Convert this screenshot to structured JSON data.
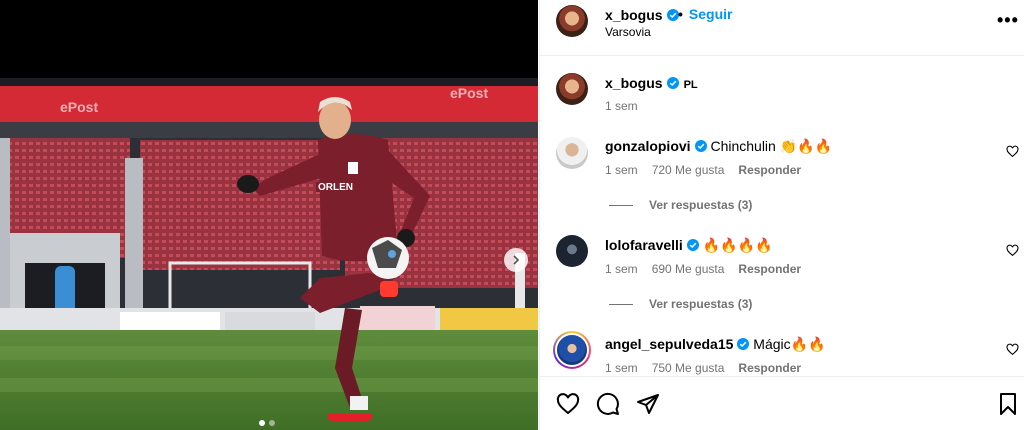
{
  "post": {
    "author": "x_bogus",
    "follow_label": "Seguir",
    "separator": "•",
    "location": "Varsovia",
    "more_label": "•••",
    "caption": "PL",
    "caption_time": "1 sem"
  },
  "comments": [
    {
      "username": "gonzalopiovi",
      "text": "Chinchulin 👏🔥🔥",
      "time": "1 sem",
      "likes": "720 Me gusta",
      "reply_label": "Responder",
      "view_replies": "Ver respuestas (3)"
    },
    {
      "username": "lolofaravelli",
      "text": "🔥🔥🔥🔥",
      "time": "1 sem",
      "likes": "690 Me gusta",
      "reply_label": "Responder",
      "view_replies": "Ver respuestas (3)"
    },
    {
      "username": "angel_sepulveda15",
      "text": "Mágic🔥🔥",
      "time": "1 sem",
      "likes": "750 Me gusta",
      "reply_label": "Responder"
    }
  ],
  "carousel": {
    "slides": 2,
    "active": 1
  },
  "icons": {
    "verified": "verified-badge-icon",
    "more": "more-options-icon",
    "heart": "heart-icon",
    "comment": "comment-icon",
    "share": "share-icon",
    "save": "bookmark-icon",
    "next": "chevron-right-icon"
  },
  "colors": {
    "accent": "#0095f6",
    "verified": "#0095f6",
    "muted": "#737373",
    "kit": "#7a1f2b"
  }
}
